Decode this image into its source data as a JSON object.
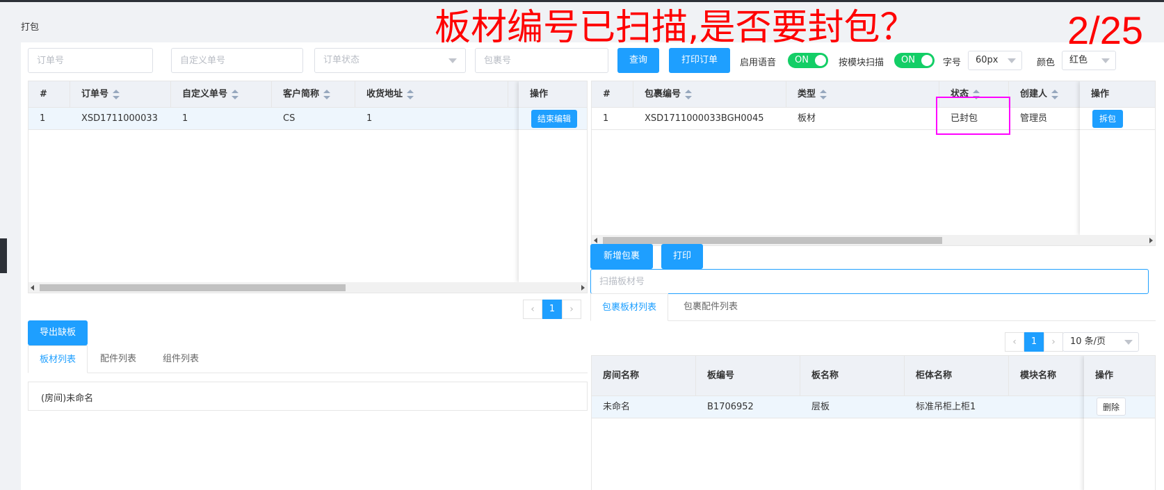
{
  "panel_title": "打包",
  "overlay": {
    "message": "板材编号已扫描,是否要封包？",
    "counter": "2/25"
  },
  "colors": {
    "accent": "#1e9fff",
    "switch_on": "#13ce66",
    "overlay_text": "#ff0000",
    "highlight_box": "#ff00ff"
  },
  "filters": {
    "order_no_placeholder": "订单号",
    "custom_no_placeholder": "自定义单号",
    "order_status_placeholder": "订单状态",
    "package_no_placeholder": "包裹号",
    "query_label": "查询",
    "print_order_label": "打印订单",
    "voice_label": "启用语音",
    "voice_state": "ON",
    "module_scan_label": "按模块扫描",
    "module_scan_state": "ON",
    "font_size_label": "字号",
    "font_size_value": "60px",
    "color_label": "颜色",
    "color_value": "红色"
  },
  "orders_table": {
    "columns": [
      "#",
      "订单号",
      "自定义单号",
      "客户简称",
      "收货地址",
      "操作"
    ],
    "rows": [
      {
        "index": "1",
        "order_no": "XSD1711000033",
        "custom_no": "1",
        "customer": "CS",
        "address": "1",
        "action": "结束编辑"
      }
    ],
    "page": "1"
  },
  "packages_table": {
    "columns": [
      "#",
      "包裹编号",
      "类型",
      "状态",
      "创建人",
      "操作"
    ],
    "rows": [
      {
        "index": "1",
        "package_no": "XSD1711000033BGH0045",
        "type": "板材",
        "status": "已封包",
        "creator": "管理员",
        "action": "拆包"
      }
    ]
  },
  "package_actions": {
    "add_label": "新增包裹",
    "print_label": "打印",
    "scan_placeholder": "扫描板材号"
  },
  "export_label": "导出缺板",
  "left_tabs": [
    "板材列表",
    "配件列表",
    "组件列表"
  ],
  "left_list": {
    "item": "(房间)未命名"
  },
  "right_tabs": [
    "包裹板材列表",
    "包裹配件列表"
  ],
  "right_pager": {
    "page": "1",
    "page_size": "10 条/页"
  },
  "boards_table": {
    "columns": [
      "房间名称",
      "板编号",
      "板名称",
      "柜体名称",
      "模块名称",
      "操作"
    ],
    "rows": [
      {
        "room": "未命名",
        "board_no": "B1706952",
        "board_name": "层板",
        "cabinet": "标准吊柜上柜1",
        "module": "",
        "action": "删除"
      }
    ]
  }
}
